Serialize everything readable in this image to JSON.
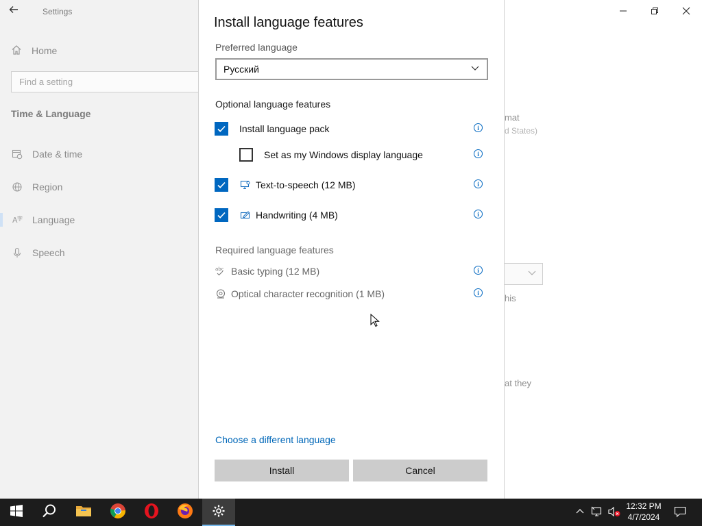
{
  "window": {
    "title": "Settings",
    "minimize": "–",
    "restore": "❐",
    "close": "✕"
  },
  "sidebar": {
    "home": "Home",
    "search_placeholder": "Find a setting",
    "section": "Time & Language",
    "items": [
      {
        "label": "Date & time",
        "icon": "calendar-clock-icon"
      },
      {
        "label": "Region",
        "icon": "globe-icon"
      },
      {
        "label": "Language",
        "icon": "language-icon"
      },
      {
        "label": "Speech",
        "icon": "microphone-icon"
      }
    ]
  },
  "background_fragments": {
    "format": "mat",
    "region": "d States)",
    "this": "his",
    "they": "at they"
  },
  "dialog": {
    "title": "Install language features",
    "preferred_label": "Preferred language",
    "preferred_value": "Русский",
    "optional_heading": "Optional language features",
    "optional": [
      {
        "label": "Install language pack",
        "checked": true
      },
      {
        "label": "Set as my Windows display language",
        "checked": false
      },
      {
        "label": "Text-to-speech (12 MB)",
        "checked": true,
        "icon": "text-to-speech-icon"
      },
      {
        "label": "Handwriting (4 MB)",
        "checked": true,
        "icon": "handwriting-icon"
      }
    ],
    "required_heading": "Required language features",
    "required": [
      {
        "label": "Basic typing (12 MB)",
        "icon": "basic-typing-icon"
      },
      {
        "label": "Optical character recognition (1 MB)",
        "icon": "ocr-icon"
      }
    ],
    "info_glyph": "i",
    "link": "Choose a different language",
    "install_button": "Install",
    "cancel_button": "Cancel"
  },
  "taskbar": {
    "time": "12:32 PM",
    "date": "4/7/2024",
    "apps": [
      "start-icon",
      "search-icon",
      "file-explorer-icon",
      "chrome-icon",
      "opera-icon",
      "firefox-icon",
      "settings-icon"
    ]
  },
  "colors": {
    "accent": "#0067c0",
    "link": "#0067b8",
    "taskbar": "#1c1c1c",
    "button": "#cccccc",
    "sidebar": "#f2f2f2"
  }
}
